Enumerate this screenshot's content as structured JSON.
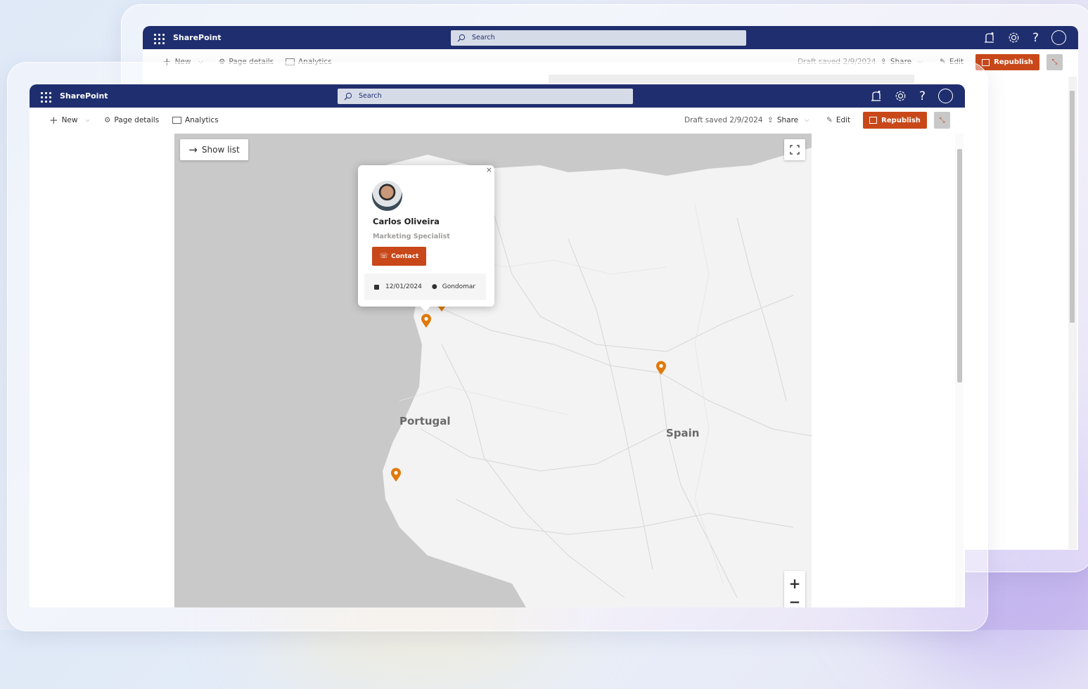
{
  "app": {
    "brand": "SharePoint",
    "search_placeholder": "Search"
  },
  "toolbar": {
    "new_label": "New",
    "page_details_label": "Page details",
    "analytics_label": "Analytics",
    "draft_status": "Draft saved 2/9/2024",
    "share_label": "Share",
    "edit_label": "Edit",
    "republish_label": "Republish"
  },
  "map": {
    "show_list_label": "Show list",
    "countries": [
      "Portugal",
      "Spain"
    ],
    "zoom_in": "+",
    "zoom_out": "−"
  },
  "popup": {
    "name": "Carlos Oliveira",
    "title": "Marketing Specialist",
    "contact_label": "Contact",
    "date": "12/01/2024",
    "location": "Gondomar",
    "close": "×"
  },
  "colors": {
    "suitebar": "#1f2e6e",
    "accent": "#c8481a",
    "pin": "#e07a0c"
  },
  "icons": [
    "waffle-icon",
    "search-icon",
    "megaphone-icon",
    "gear-icon",
    "help-icon",
    "avatar-icon",
    "plus-icon",
    "chevron-down-icon",
    "gear-icon",
    "analytics-icon",
    "share-icon",
    "pencil-icon",
    "book-icon",
    "collapse-icon",
    "arrow-right-icon",
    "fullscreen-icon",
    "calendar-icon",
    "location-pin-icon",
    "contact-icon",
    "close-icon",
    "map-pin-icon"
  ]
}
